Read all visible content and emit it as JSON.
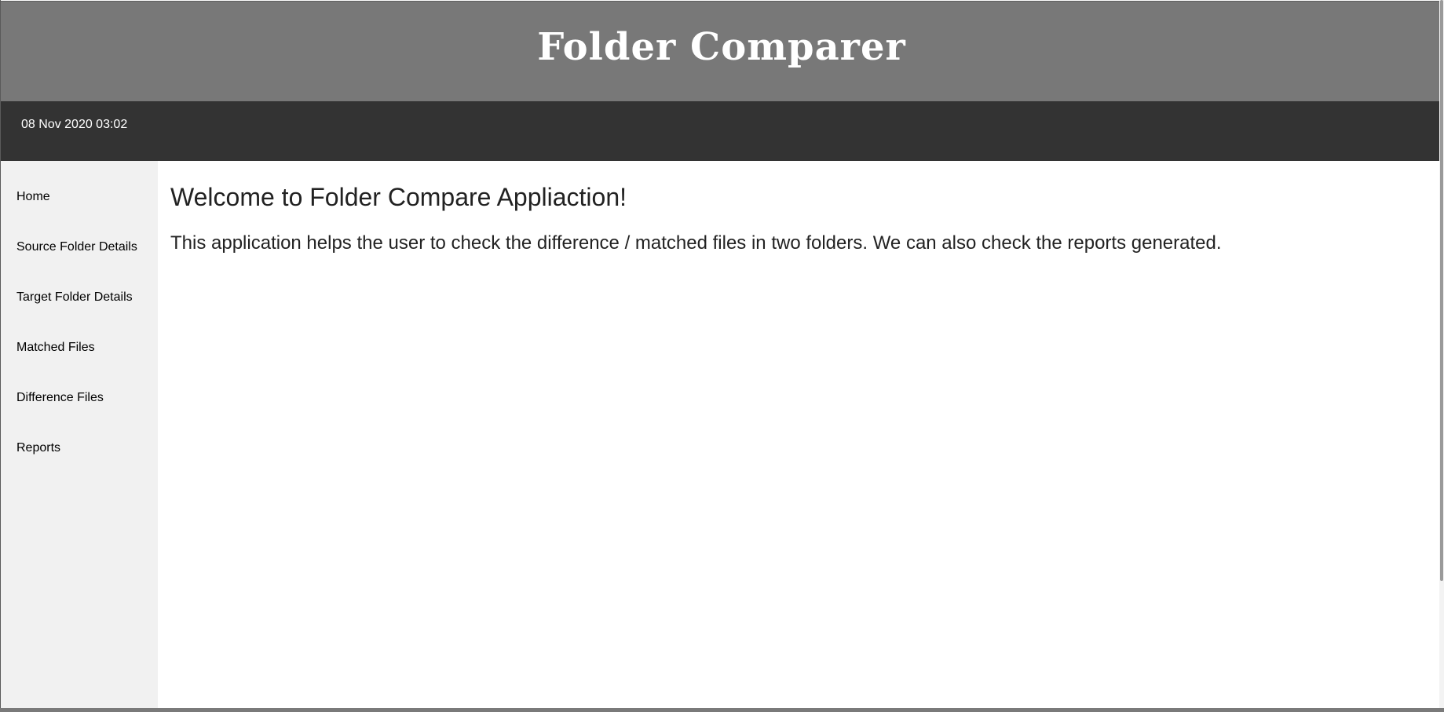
{
  "header": {
    "title": "Folder Comparer"
  },
  "datebar": {
    "datetime": "08 Nov 2020 03:02"
  },
  "sidebar": {
    "items": [
      {
        "label": "Home"
      },
      {
        "label": "Source Folder Details"
      },
      {
        "label": "Target Folder Details"
      },
      {
        "label": "Matched Files"
      },
      {
        "label": "Difference Files"
      },
      {
        "label": "Reports"
      }
    ]
  },
  "main": {
    "heading": "Welcome to Folder Compare Appliaction!",
    "description": "This application helps the user to check the difference / matched files in two folders. We can also check the reports generated."
  },
  "colors": {
    "header_bg": "#787878",
    "datebar_bg": "#333333",
    "sidebar_bg": "#f1f1f1"
  }
}
